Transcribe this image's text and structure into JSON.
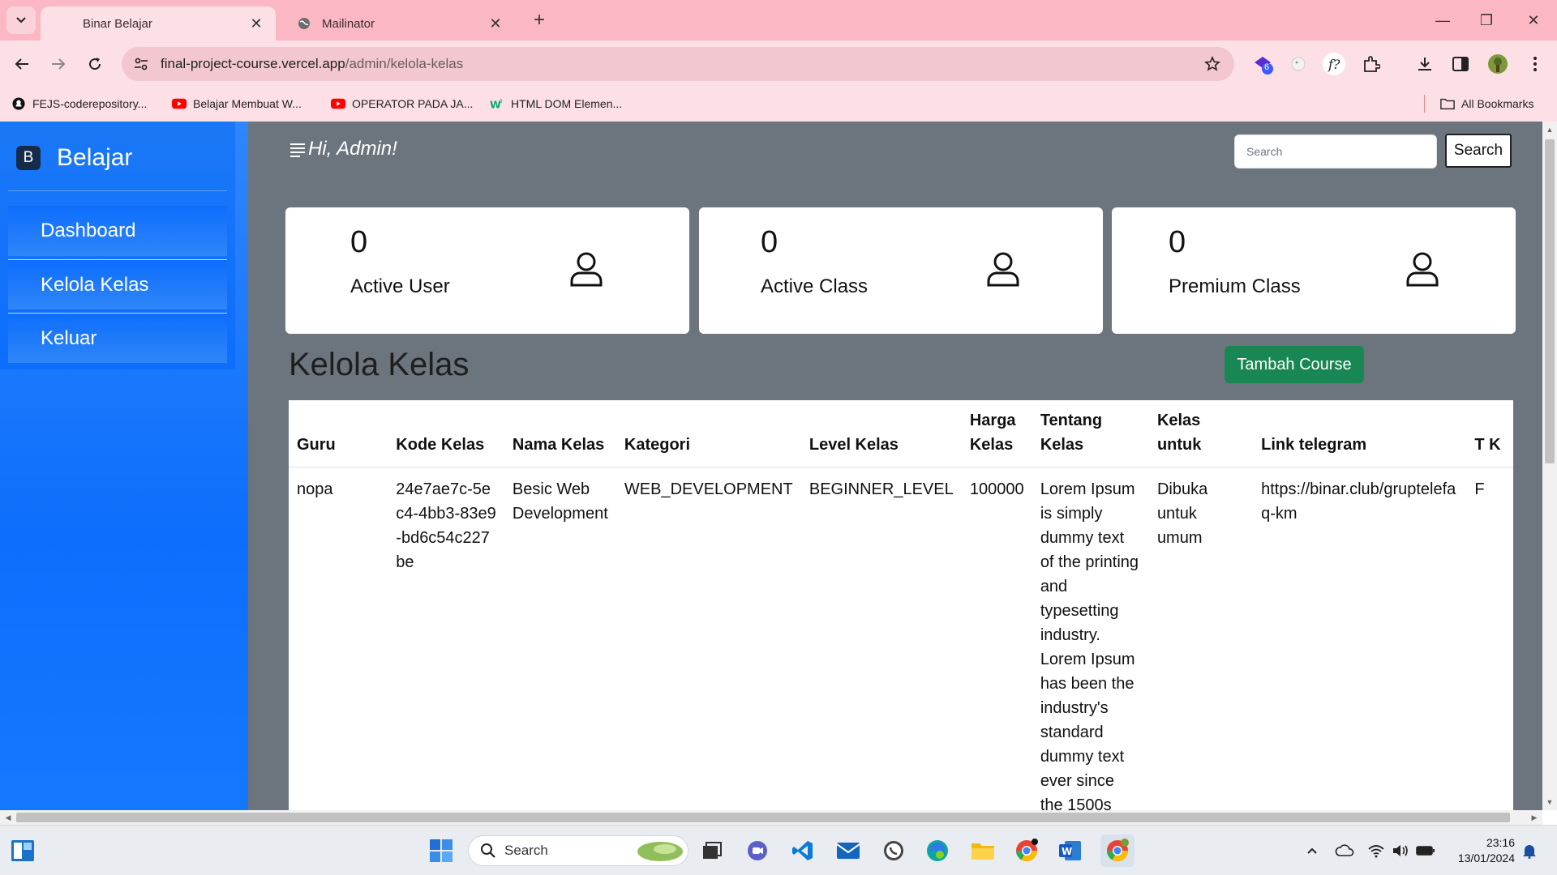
{
  "browser": {
    "tabs": [
      {
        "title": "Binar Belajar",
        "active": true
      },
      {
        "title": "Mailinator",
        "active": false
      }
    ],
    "url_host": "final-project-course.vercel.app",
    "url_path": "/admin/kelola-kelas",
    "bookmarks": [
      {
        "label": "FEJS-coderepository...",
        "icon": "github-icon"
      },
      {
        "label": "Belajar Membuat W...",
        "icon": "youtube-icon"
      },
      {
        "label": "OPERATOR PADA JA...",
        "icon": "youtube-icon"
      },
      {
        "label": "HTML DOM Elemen...",
        "icon": "w3schools-icon"
      }
    ],
    "all_bookmarks_label": "All Bookmarks",
    "extension_badge": "6"
  },
  "sidebar": {
    "brand_logo": "B",
    "brand_name": "Belajar",
    "items": [
      {
        "label": "Dashboard"
      },
      {
        "label": "Kelola Kelas"
      },
      {
        "label": "Keluar"
      }
    ]
  },
  "topnav": {
    "greeting": "Hi, Admin!",
    "search_placeholder": "Search",
    "search_button": "Search"
  },
  "stats": [
    {
      "value": "0",
      "label": "Active User"
    },
    {
      "value": "0",
      "label": "Active Class"
    },
    {
      "value": "0",
      "label": "Premium Class"
    }
  ],
  "section": {
    "title": "Kelola Kelas",
    "add_button": "Tambah Course"
  },
  "table": {
    "headers": [
      "Guru",
      "Kode Kelas",
      "Nama Kelas",
      "Kategori",
      "Level Kelas",
      "Harga Kelas",
      "Tentang Kelas",
      "Kelas untuk",
      "Link telegram",
      "T K"
    ],
    "rows": [
      [
        "nopa",
        "24e7ae7c-5ec4-4bb3-83e9-bd6c54c227be",
        "Besic Web Development",
        "WEB_DEVELOPMENT",
        "BEGINNER_LEVEL",
        "100000",
        "Lorem Ipsum is simply dummy text of the printing and typesetting industry. Lorem Ipsum has been the industry's standard dummy text ever since the 1500s",
        "Dibuka untuk umum",
        "https://binar.club/gruptelefaq-km",
        "F"
      ]
    ]
  },
  "taskbar": {
    "search_label": "Search",
    "time": "23:16",
    "date": "13/01/2024"
  },
  "colors": {
    "tabstrip": "#fbb8c4",
    "toolbar": "#fde0e6",
    "sidebar": "#0d6efd",
    "content_bg": "#6c757d",
    "add_button": "#198754"
  }
}
